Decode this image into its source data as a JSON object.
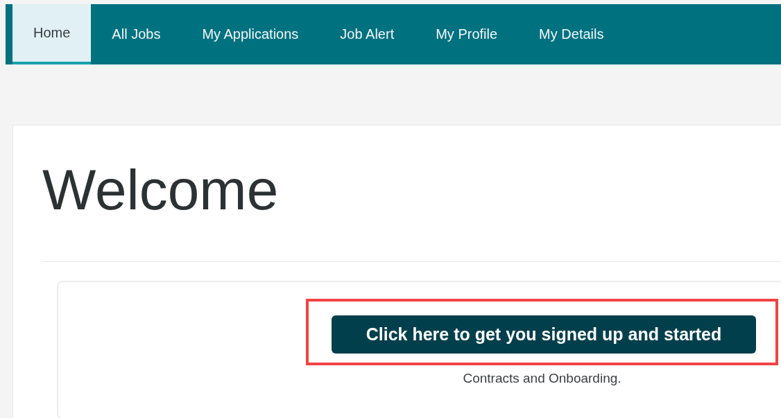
{
  "nav": {
    "tabs": [
      {
        "label": "Home",
        "selected": true
      },
      {
        "label": "All Jobs",
        "selected": false
      },
      {
        "label": "My Applications",
        "selected": false
      },
      {
        "label": "Job Alert",
        "selected": false
      },
      {
        "label": "My Profile",
        "selected": false
      },
      {
        "label": "My Details",
        "selected": false
      }
    ]
  },
  "heading": "Welcome",
  "call_to_action": {
    "label": "Click here to get you signed up and started",
    "highlighted": true
  },
  "caption": "Contracts and Onboarding."
}
